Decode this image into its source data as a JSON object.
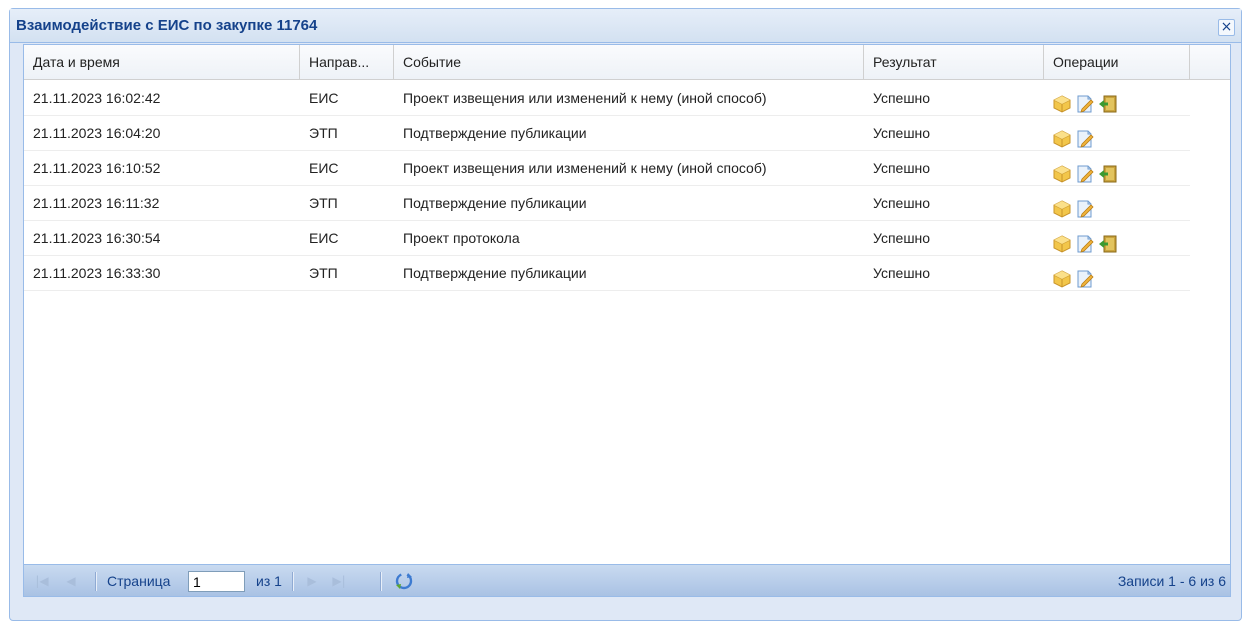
{
  "window": {
    "title": "Взаимодействие с ЕИС по закупке 11764",
    "close_label": "×"
  },
  "grid": {
    "columns": [
      "Дата и время",
      "Направ...",
      "Событие",
      "Результат",
      "Операции"
    ],
    "rows": [
      {
        "datetime": "21.11.2023 16:02:42",
        "direction": "ЕИС",
        "event": "Проект извещения или изменений к нему (иной способ)",
        "result": "Успешно",
        "operations": [
          "package-icon",
          "document-edit-icon",
          "exit-door-icon"
        ]
      },
      {
        "datetime": "21.11.2023 16:04:20",
        "direction": "ЭТП",
        "event": "Подтверждение публикации",
        "result": "Успешно",
        "operations": [
          "package-icon",
          "document-edit-icon"
        ]
      },
      {
        "datetime": "21.11.2023 16:10:52",
        "direction": "ЕИС",
        "event": "Проект извещения или изменений к нему (иной способ)",
        "result": "Успешно",
        "operations": [
          "package-icon",
          "document-edit-icon",
          "exit-door-icon"
        ]
      },
      {
        "datetime": "21.11.2023 16:11:32",
        "direction": "ЭТП",
        "event": "Подтверждение публикации",
        "result": "Успешно",
        "operations": [
          "package-icon",
          "document-edit-icon"
        ]
      },
      {
        "datetime": "21.11.2023 16:30:54",
        "direction": "ЕИС",
        "event": "Проект протокола",
        "result": "Успешно",
        "operations": [
          "package-icon",
          "document-edit-icon",
          "exit-door-icon"
        ]
      },
      {
        "datetime": "21.11.2023 16:33:30",
        "direction": "ЭТП",
        "event": "Подтверждение публикации",
        "result": "Успешно",
        "operations": [
          "package-icon",
          "document-edit-icon"
        ]
      }
    ]
  },
  "pager": {
    "page_label": "Страница",
    "page_value": "1",
    "of_label": "из 1",
    "records_label": "Записи 1 - 6 из 6",
    "first_icon": "first-page-icon",
    "prev_icon": "prev-page-icon",
    "next_icon": "next-page-icon",
    "last_icon": "last-page-icon",
    "refresh_icon": "refresh-icon"
  },
  "colors": {
    "title_text": "#15428b",
    "frame_border": "#99bbe8",
    "pager_bg": "#b3c9e8"
  }
}
